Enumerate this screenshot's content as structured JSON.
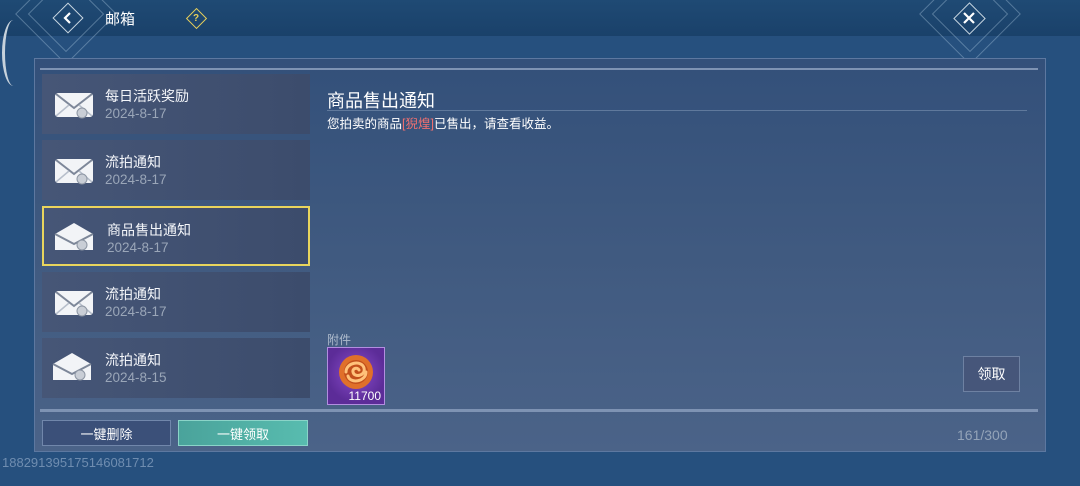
{
  "header": {
    "title": "邮箱",
    "help_label": "?"
  },
  "mail_list": [
    {
      "title": "每日活跃奖励",
      "date": "2024-8-17",
      "opened": false,
      "selected": false
    },
    {
      "title": "流拍通知",
      "date": "2024-8-17",
      "opened": false,
      "selected": false
    },
    {
      "title": "商品售出通知",
      "date": "2024-8-17",
      "opened": true,
      "selected": true
    },
    {
      "title": "流拍通知",
      "date": "2024-8-17",
      "opened": false,
      "selected": false
    },
    {
      "title": "流拍通知",
      "date": "2024-8-15",
      "opened": true,
      "selected": false
    }
  ],
  "detail": {
    "title": "商品售出通知",
    "text_before": "您拍卖的商品",
    "item_name": "[猊煌]",
    "text_after": "已售出，请查看收益。",
    "attachment_label": "附件",
    "attachment": {
      "icon": "swirl-currency-icon",
      "count": "11700"
    },
    "claim_label": "领取"
  },
  "footer": {
    "delete_all_label": "一键删除",
    "claim_all_label": "一键领取",
    "mail_count": "161/300"
  },
  "uid": "188291395175146081712",
  "colors": {
    "selected_border": "#e8d55d",
    "highlight_text": "#f07070",
    "claim_all_button": "#52b1a5",
    "attachment_bg": "#6f3bb0"
  }
}
